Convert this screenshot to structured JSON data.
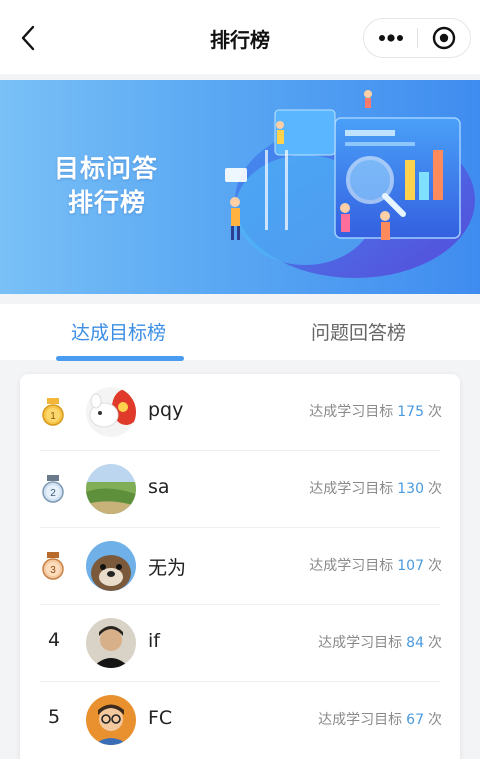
{
  "navbar": {
    "title": "排行榜"
  },
  "banner": {
    "line1": "目标问答",
    "line2": "排行榜"
  },
  "tabs": [
    {
      "label": "达成目标榜",
      "active": true
    },
    {
      "label": "问题回答榜",
      "active": false
    }
  ],
  "ranking": [
    {
      "rank": "1",
      "name": "pqy",
      "stat_label": "达成学习目标",
      "count": "175",
      "unit": "次"
    },
    {
      "rank": "2",
      "name": "sa",
      "stat_label": "达成学习目标",
      "count": "130",
      "unit": "次"
    },
    {
      "rank": "3",
      "name": "无为",
      "stat_label": "达成学习目标",
      "count": "107",
      "unit": "次"
    },
    {
      "rank": "4",
      "name": "if",
      "stat_label": "达成学习目标",
      "count": "84",
      "unit": "次"
    },
    {
      "rank": "5",
      "name": "FC",
      "stat_label": "达成学习目标",
      "count": "67",
      "unit": "次"
    }
  ],
  "colors": {
    "accent": "#4a9cf0",
    "banner_start": "#79c0f6",
    "banner_end": "#3f8cf0"
  }
}
